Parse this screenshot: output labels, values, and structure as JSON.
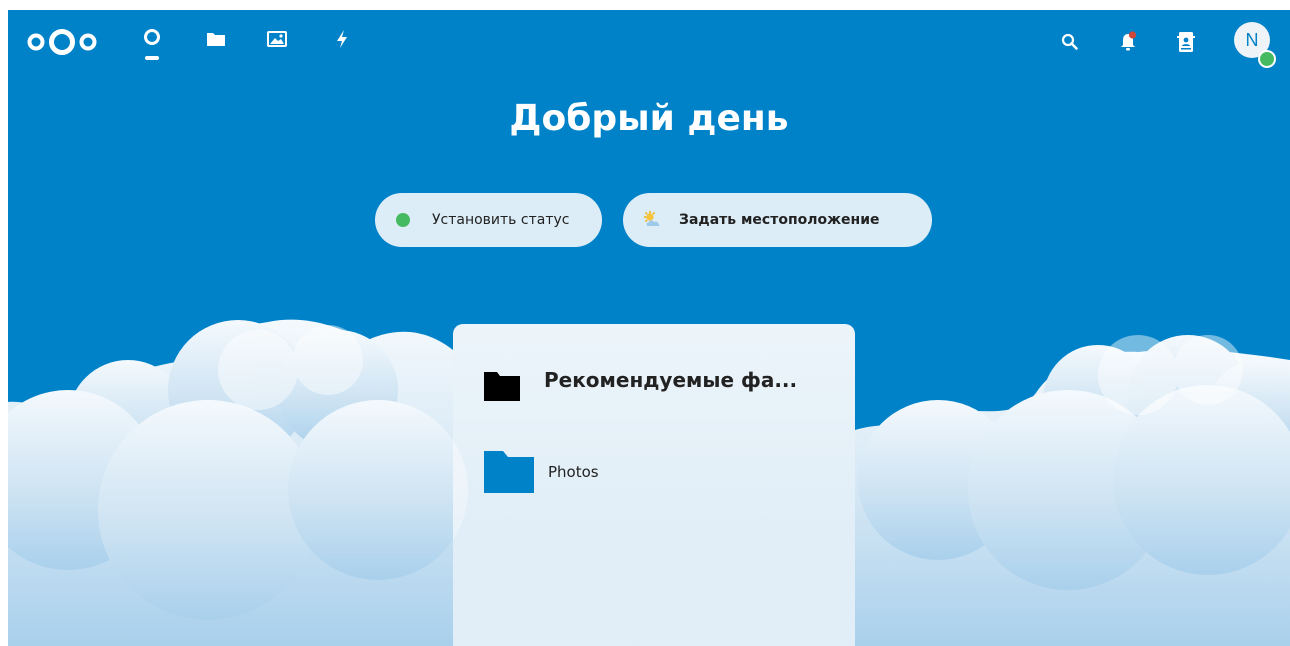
{
  "header": {
    "apps": [
      {
        "name": "dashboard",
        "icon": "dashboard-icon",
        "active": true
      },
      {
        "name": "files",
        "icon": "folder-icon"
      },
      {
        "name": "photos",
        "icon": "image-icon"
      },
      {
        "name": "activity",
        "icon": "lightning-icon"
      }
    ],
    "right_icons": [
      "search-icon",
      "notifications-icon",
      "contacts-icon"
    ],
    "avatar_initial": "N",
    "avatar_status_color": "#46ba61"
  },
  "greeting": "Добрый день",
  "status_button": {
    "label": "Установить статус",
    "dot_color": "#46ba61"
  },
  "location_button": {
    "label": "Задать местоположение",
    "icon": "weather-sun-cloud-icon"
  },
  "widget": {
    "title": "Рекомендуемые фа...",
    "icon": "folder-icon",
    "items": [
      {
        "label": "Photos",
        "icon": "folder-icon",
        "color": "#0082c9"
      }
    ]
  },
  "colors": {
    "brand": "#0082c9",
    "status_online": "#46ba61"
  }
}
